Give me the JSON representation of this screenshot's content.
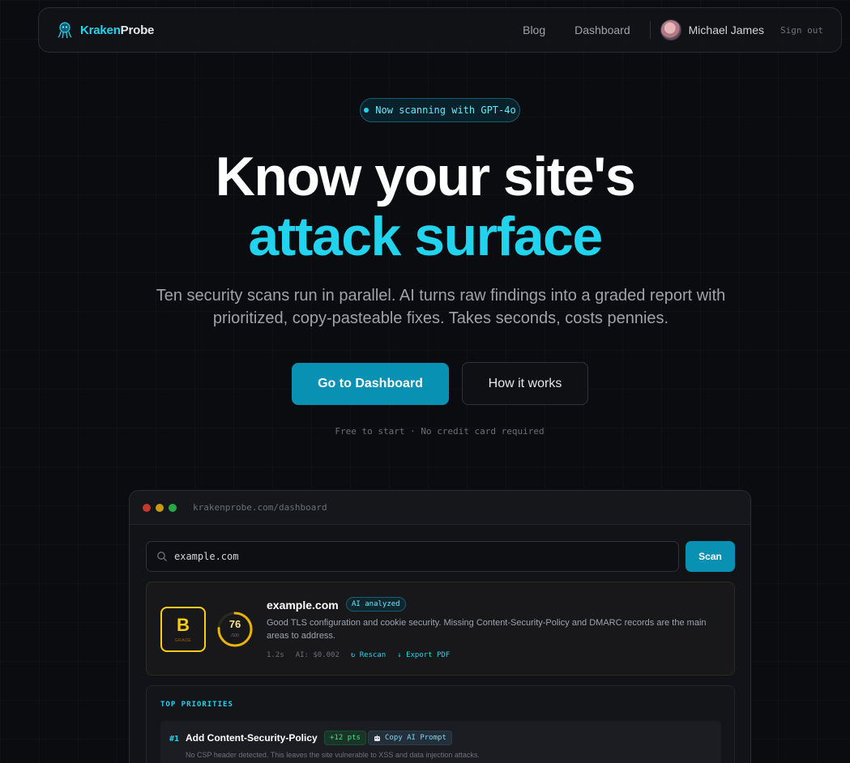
{
  "nav": {
    "brand_part1": "Kraken",
    "brand_part2": "Probe",
    "links": [
      "Blog",
      "Dashboard"
    ],
    "user_name": "Michael James",
    "signout_label": "Sign out"
  },
  "hero": {
    "pill_text": "Now scanning with GPT-4o",
    "title_line1": "Know your site's",
    "title_line2": "attack surface",
    "subtitle": "Ten security scans run in parallel. AI turns raw findings into a graded report with prioritized, copy-pasteable fixes. Takes seconds, costs pennies.",
    "primary_cta": "Go to Dashboard",
    "secondary_cta": "How it works",
    "note": "Free to start · No credit card required"
  },
  "mock": {
    "url": "krakenprobe.com/dashboard",
    "search_value": "example.com",
    "scan_label": "Scan",
    "result": {
      "grade": "B",
      "grade_label": "GRADE",
      "score": 76,
      "score_max_label": "/100",
      "domain": "example.com",
      "ai_badge": "AI analyzed",
      "description": "Good TLS configuration and cookie security. Missing Content-Security-Policy and DMARC records are the main areas to address.",
      "duration": "1.2s",
      "ai_cost": "AI: $0.002",
      "rescan_label": "↻ Rescan",
      "export_label": "↓ Export PDF"
    },
    "priorities": {
      "title": "TOP PRIORITIES",
      "items": [
        {
          "rank": "#1",
          "name": "Add Content-Security-Policy",
          "points": "+12 pts",
          "copy_label": "Copy AI Prompt",
          "description": "No CSP header detected. This leaves the site vulnerable to XSS and data injection attacks."
        }
      ]
    }
  },
  "colors": {
    "accent": "#22d3ee",
    "primary_button": "#0891b2",
    "grade": "#facc15",
    "background": "#0b0c0f"
  }
}
